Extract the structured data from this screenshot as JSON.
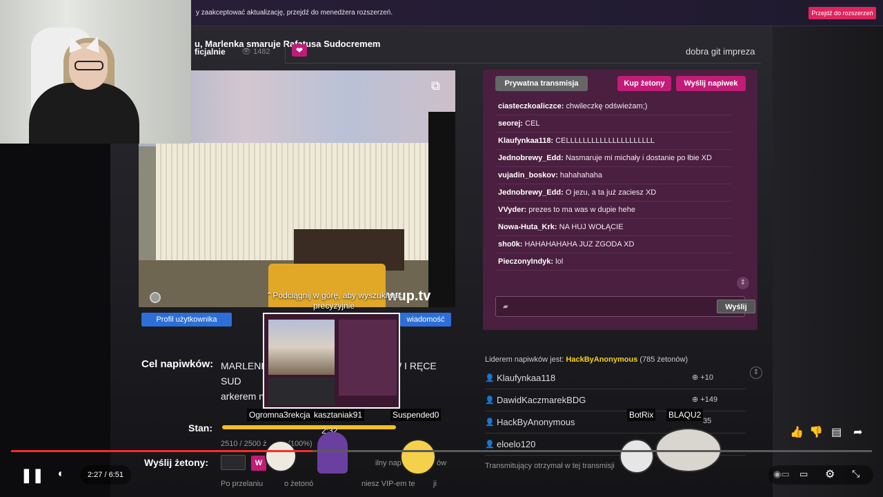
{
  "extension_banner": {
    "text": "y zaakceptować aktualizację, przejdź do menedżera rozszerzeń.",
    "button_label": "Przejdź do rozszerzeń"
  },
  "stream": {
    "title": "u, Marlenka smaruje Rafatusa Sudocremem",
    "subtitle": "ficjalnie",
    "viewers": "1482",
    "status_message": "dobra git impreza",
    "site_logo": "wup.tv"
  },
  "video_buttons": {
    "profile": "Profil użytkownika",
    "message": "wiadomość"
  },
  "search_hint": "Podciągnij w górę, aby wyszukiwać precyzyjnie",
  "chat": {
    "private_label": "Prywatna transmisja",
    "buy_label": "Kup żetony",
    "tip_label": "Wyślij napiwek",
    "send_label": "Wyślij",
    "messages": [
      {
        "user": "ciasteczkoaliczce:",
        "text": "chwileczkę odświeżam;)"
      },
      {
        "user": "seorej:",
        "text": "CEL"
      },
      {
        "user": "Klaufynkaa118:",
        "text": "CELLLLLLLLLLLLLLLLLLLLL"
      },
      {
        "user": "Jednobrewy_Edd:",
        "text": "Nasmaruje mi michały i dostanie po łbie XD"
      },
      {
        "user": "vujadin_boskov:",
        "text": "hahahahaha"
      },
      {
        "user": "Jednobrewy_Edd:",
        "text": "O jezu, a ta już zaciesz XD"
      },
      {
        "user": "VVyder:",
        "text": "prezes to ma was w dupie hehe"
      },
      {
        "user": "Nowa-Huta_Krk:",
        "text": "NA HUJ WOŁĄCIE"
      },
      {
        "user": "sho0k:",
        "text": "HAHAHAHAHA JUZ ZGODA XD"
      },
      {
        "user": "PieczonyIndyk:",
        "text": "lol"
      }
    ]
  },
  "tip_goal": {
    "label": "Cel napiwków:",
    "text": "MARLENK                                SŁADKÓW I RĘCE SUD                                 DERMATO                               arkerem na rafatu",
    "stan_label": "Stan:",
    "progress": 1.0,
    "stan_value": "2510 / 2500 ż          (100%)",
    "send_tokens_label": "Wyślij żetony:",
    "btn_fragment": "W",
    "info_fragment": "ilny napiwek",
    "info_suffix": "ów",
    "footer_prefix": "Po przelaniu",
    "footer_mid": "o żetonó",
    "footer_suffix": "niesz VIP-em te",
    "footer_end": "ji"
  },
  "leaderboard": {
    "header_prefix": "Liderem napiwków jest:",
    "leader_name": "HackByAnonymous",
    "leader_tokens": "(785 żetonów)",
    "rows": [
      {
        "name": "Klaufynkaa118",
        "amount": "+10"
      },
      {
        "name": "DawidKaczmarekBDG",
        "amount": "+149"
      },
      {
        "name": "HackByAnonymous",
        "amount": "35"
      },
      {
        "name": "eloelo120",
        "amount": ""
      }
    ],
    "footer": "Transmitujący otrzymał w tej transmisji"
  },
  "player": {
    "time": "2:27 / 6:51",
    "preview_time": "2:32",
    "progress": 0.35
  },
  "name_tags": [
    "Ogromna3rekcja",
    "kasztaniak91",
    "Suspended0",
    "BotRix",
    "BLAQU2"
  ],
  "icons": {
    "pause": "pause-icon",
    "volume": "volume-icon",
    "like": "thumb-up-icon",
    "dislike": "thumb-down-icon",
    "comment": "comment-icon",
    "share": "share-icon",
    "settings": "gear-icon",
    "exit_fullscreen": "exit-fullscreen-icon"
  }
}
